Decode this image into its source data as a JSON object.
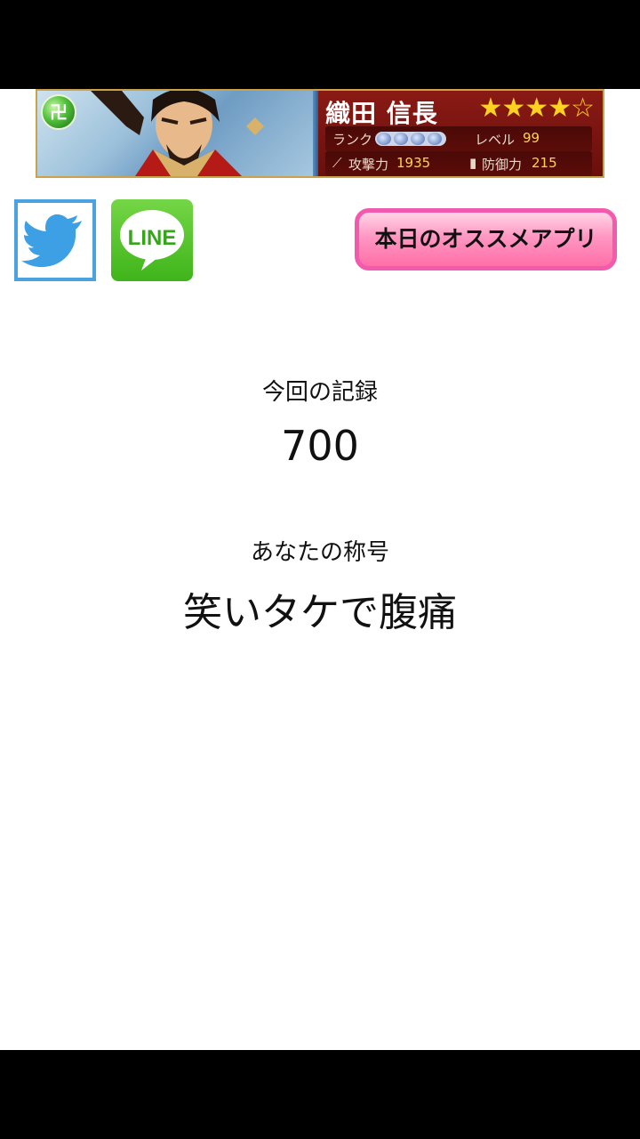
{
  "ad": {
    "character_name": "織田 信長",
    "stars": "★★★★☆",
    "gem_glyph": "卍",
    "rank_label": "ランク",
    "level_label": "レベル",
    "level_value": "99",
    "attack_label": "攻撃力",
    "attack_value": "1935",
    "defense_label": "防御力",
    "defense_value": "215"
  },
  "share": {
    "twitter_icon": "twitter-bird-icon",
    "line_label": "LINE"
  },
  "recommend_button": {
    "label": "本日のオススメアプリ"
  },
  "result": {
    "record_label": "今回の記録",
    "record_value": "700",
    "title_label": "あなたの称号",
    "title_value": "笑いタケで腹痛"
  },
  "colors": {
    "twitter_blue": "#4aa3e0",
    "line_green": "#3fb41a",
    "button_pink": "#f25aae",
    "ad_red": "#7b1010"
  }
}
